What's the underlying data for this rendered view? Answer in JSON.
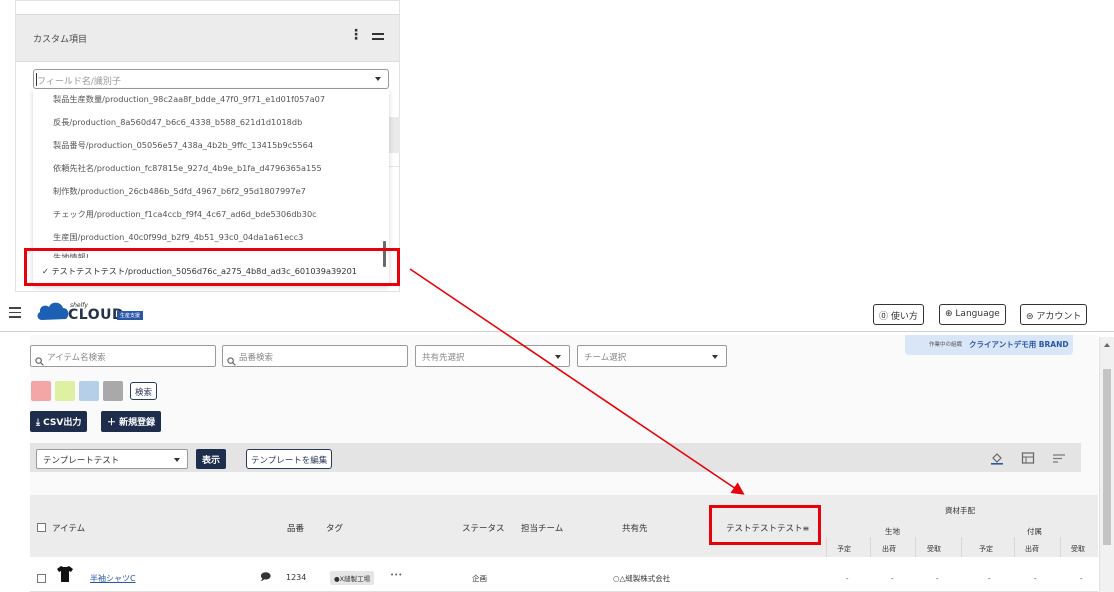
{
  "popup": {
    "title": "カスタム項目",
    "kebab": "⋮",
    "field_placeholder": "フィールド名/識別子",
    "items": [
      "製品生産数量/production_98c2aa8f_bdde_47f0_9f71_e1d01f057a07",
      "反長/production_8a560d47_b6c6_4338_b588_621d1d1018db",
      "製品番号/production_05056e57_438a_4b2b_9ffc_13415b9c5564",
      "依頼先社名/production_fc87815e_927d_4b9e_b1fa_d4796365a155",
      "制作数/production_26cb486b_5dfd_4967_b6f2_95d1807997e7",
      "チェック用/production_f1ca4ccb_f9f4_4c67_ad6d_bde5306db30c",
      "生産国/production_40c0f99d_b2f9_4b51_93c0_04da1a61ecc3",
      "生地情報!"
    ],
    "selected_check": "✓",
    "selected_item": "テストテストテスト/production_5056d76c_a275_4b8d_ad3c_601039a39201"
  },
  "header": {
    "logo_small": "shelfy",
    "logo_text": "CLOUD",
    "logo_badge": "生産支援",
    "help_button": "使い方",
    "language_button": "Language",
    "account_button": "アカウント"
  },
  "company": {
    "label": "作業中の組織",
    "name": "クライアントデモ用 BRAND"
  },
  "filters": {
    "item_search_placeholder": "アイテム名検索",
    "part_search_placeholder": "品番検索",
    "share_select_placeholder": "共有先選択",
    "team_select_placeholder": "チーム選択",
    "search_button": "検索",
    "swatch_colors": [
      "#f4a6a6",
      "#dff0a3",
      "#b5cfe8",
      "#a9a9a9"
    ]
  },
  "actions": {
    "csv_button": "CSV出力",
    "new_button": "新規登録"
  },
  "template": {
    "selected": "テンプレートテスト",
    "show_button": "表示",
    "edit_button": "テンプレートを編集"
  },
  "table": {
    "headers": {
      "item": "アイテム",
      "part_no": "品番",
      "tag": "タグ",
      "status": "ステータス",
      "team": "担当チーム",
      "share": "共有先",
      "custom": "テストテストテスト",
      "materials": "資材手配",
      "fabric": "生地",
      "accessories": "付属",
      "sub": [
        "予定",
        "出荷",
        "受取",
        "予定",
        "出荷",
        "受取"
      ]
    },
    "rows": [
      {
        "item": "半袖シャツC",
        "part_no": "1234",
        "tag": "●X縫製工場",
        "tag_more": "•••",
        "status": "企画",
        "share": "○△縫製株式会社",
        "dash": "-"
      }
    ]
  },
  "colors": {
    "highlight": "#e8000b",
    "navy": "#1f2d4d",
    "brand_blue": "#2a56a8"
  }
}
